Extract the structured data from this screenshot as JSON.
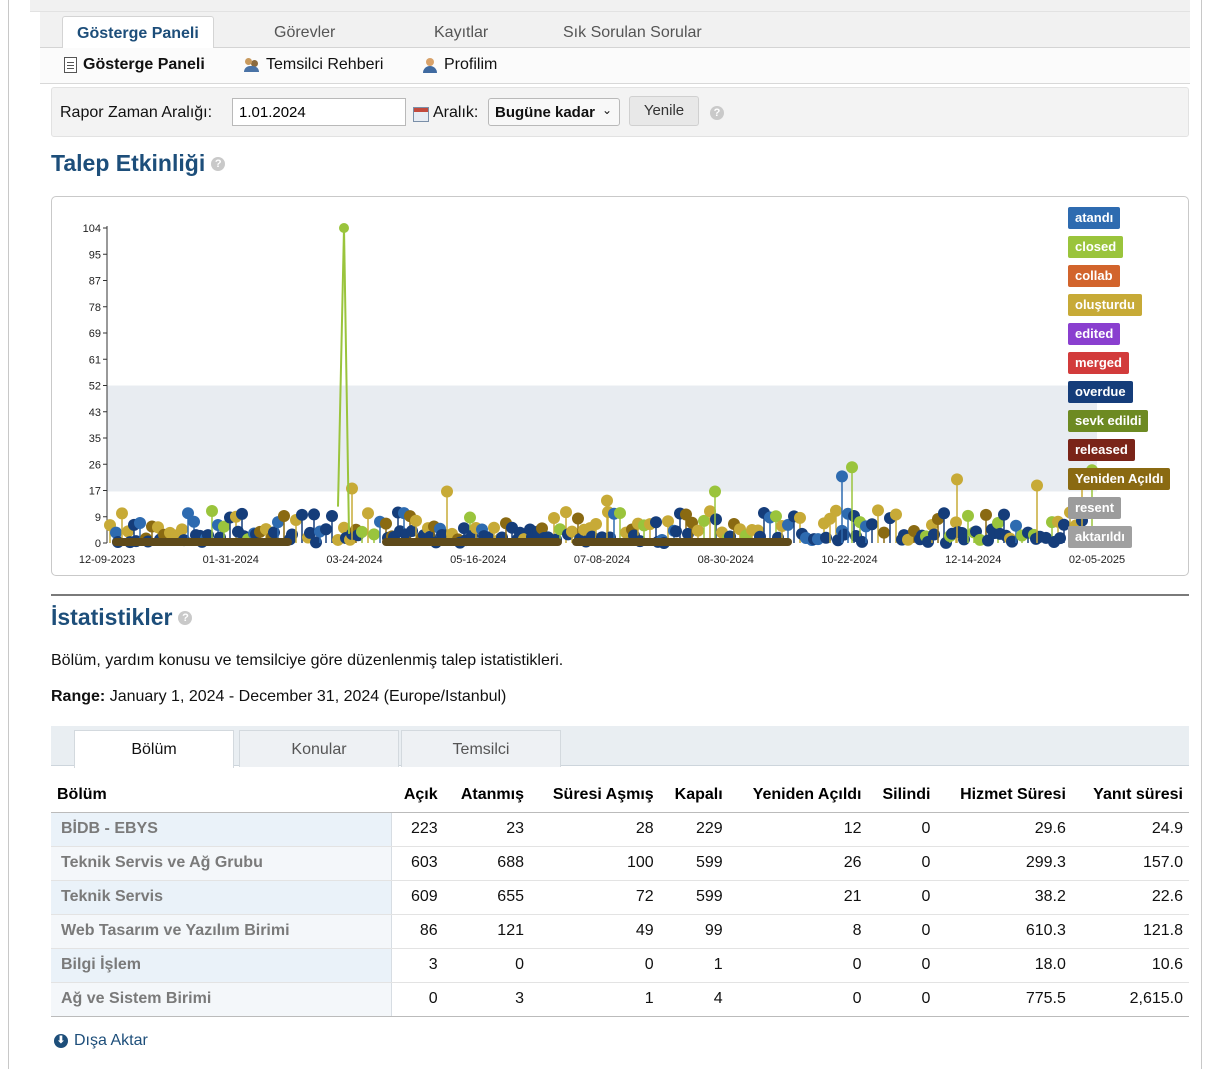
{
  "nav": {
    "tabs": [
      {
        "label": "Gösterge Paneli"
      },
      {
        "label": "Görevler"
      },
      {
        "label": "Kayıtlar"
      },
      {
        "label": "Sık Sorulan Sorular"
      }
    ],
    "sub": [
      {
        "label": "Gösterge Paneli",
        "icon": "document-icon"
      },
      {
        "label": "Temsilci Rehberi",
        "icon": "people-icon"
      },
      {
        "label": "Profilim",
        "icon": "person-icon"
      }
    ]
  },
  "filter": {
    "range_label": "Rapor Zaman Aralığı:",
    "date_value": "1.01.2024",
    "period_label": "Aralık:",
    "period_value": "Bugüne kadar",
    "refresh_label": "Yenile",
    "help_glyph": "?"
  },
  "activity": {
    "title": "Talep Etkinliği"
  },
  "chart_data": {
    "type": "line",
    "y_ticks": [
      "104",
      "95",
      "87",
      "78",
      "69",
      "61",
      "52",
      "43",
      "35",
      "26",
      "17",
      "9",
      "0"
    ],
    "x_ticks": [
      "12-09-2023",
      "01-31-2024",
      "03-24-2024",
      "05-16-2024",
      "07-08-2024",
      "08-30-2024",
      "10-22-2024",
      "12-14-2024",
      "02-05-2025"
    ],
    "ylim": [
      0,
      104
    ],
    "series_legend": [
      {
        "name": "atandı",
        "color": "#2e6bb0"
      },
      {
        "name": "closed",
        "color": "#9ac43c"
      },
      {
        "name": "collab",
        "color": "#d2642c"
      },
      {
        "name": "oluşturdu",
        "color": "#c7aa37"
      },
      {
        "name": "edited",
        "color": "#8a3fcf"
      },
      {
        "name": "merged",
        "color": "#d23b3b"
      },
      {
        "name": "overdue",
        "color": "#153d7a"
      },
      {
        "name": "sevk edildi",
        "color": "#6d8a22"
      },
      {
        "name": "released",
        "color": "#7a2418"
      },
      {
        "name": "Yeniden Açıldı",
        "color": "#8a6a12"
      },
      {
        "name": "resent",
        "color": "#9c9c9c"
      },
      {
        "name": "aktarıldı",
        "color": "#a0a0a0"
      }
    ],
    "peak": {
      "date": "03-13-2024",
      "value": 104,
      "series": "closed"
    }
  },
  "stats": {
    "title": "İstatistikler",
    "description": "Bölüm, yardım konusu ve temsilciye göre düzenlenmiş talep istatistikleri.",
    "range_label": "Range:",
    "range_value": "January 1, 2024 - December 31, 2024 (Europe/Istanbul)",
    "tabs": [
      {
        "label": "Bölüm"
      },
      {
        "label": "Konular"
      },
      {
        "label": "Temsilci"
      }
    ],
    "headers": [
      "Bölüm",
      "Açık",
      "Atanmış",
      "Süresi Aşmış",
      "Kapalı",
      "Yeniden Açıldı",
      "Silindi",
      "Hizmet Süresi",
      "Yanıt süresi"
    ],
    "rows": [
      [
        "BİDB - EBYS",
        "223",
        "23",
        "28",
        "229",
        "12",
        "0",
        "29.6",
        "24.9"
      ],
      [
        "Teknik Servis ve Ağ Grubu",
        "603",
        "688",
        "100",
        "599",
        "26",
        "0",
        "299.3",
        "157.0"
      ],
      [
        "Teknik Servis",
        "609",
        "655",
        "72",
        "599",
        "21",
        "0",
        "38.2",
        "22.6"
      ],
      [
        "Web Tasarım ve Yazılım Birimi",
        "86",
        "121",
        "49",
        "99",
        "8",
        "0",
        "610.3",
        "121.8"
      ],
      [
        "Bilgi İşlem",
        "3",
        "0",
        "0",
        "1",
        "0",
        "0",
        "18.0",
        "10.6"
      ],
      [
        "Ağ ve Sistem Birimi",
        "0",
        "3",
        "1",
        "4",
        "0",
        "0",
        "775.5",
        "2,615.0"
      ]
    ],
    "export_label": "Dışa Aktar"
  }
}
